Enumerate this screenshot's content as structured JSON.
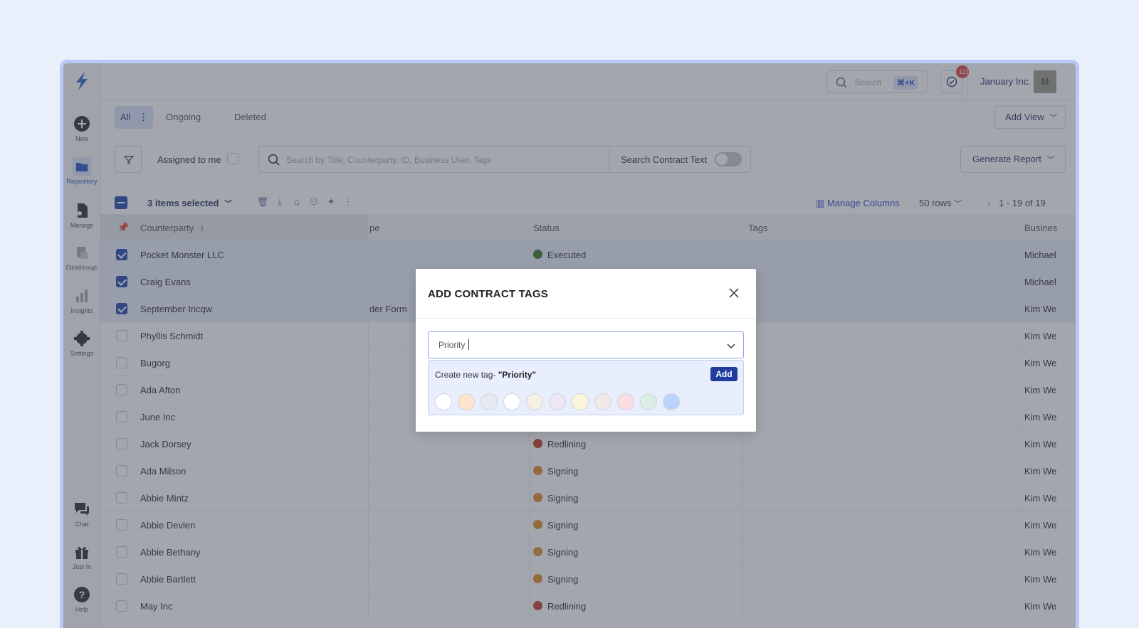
{
  "sidebar": {
    "items": [
      {
        "label": "New",
        "icon": "plus-circle-icon"
      },
      {
        "label": "Repository",
        "icon": "folder-icon"
      },
      {
        "label": "Manage",
        "icon": "manage-doc-icon"
      },
      {
        "label": "Clickthrough",
        "icon": "clickthrough-icon"
      },
      {
        "label": "Insights",
        "icon": "bar-chart-icon"
      },
      {
        "label": "Settings",
        "icon": "gear-icon"
      },
      {
        "label": "Chat",
        "icon": "chat-icon"
      },
      {
        "label": "Just In",
        "icon": "gift-icon"
      },
      {
        "label": "Help",
        "icon": "help-icon"
      }
    ]
  },
  "header": {
    "search_placeholder": "Search",
    "search_shortcut": "⌘+K",
    "notification_count": "12",
    "company": "January Inc.",
    "avatar_initial": "M"
  },
  "tabs": {
    "all": "All",
    "ongoing": "Ongoing",
    "deleted": "Deleted",
    "add_view": "Add View"
  },
  "filters": {
    "assigned_to_me": "Assigned to me",
    "search_placeholder": "Search by Title, Counterparty, ID, Business User, Tags",
    "search_contract_text": "Search Contract Text",
    "generate_report": "Generate Report"
  },
  "selection": {
    "count_label": "3 items selected",
    "manage_columns": "Manage Columns",
    "rows_per_page": "50 rows",
    "pagination": "1 - 19 of 19"
  },
  "table": {
    "headers": {
      "counterparty": "Counterparty",
      "type": "pe",
      "status": "Status",
      "tags": "Tags",
      "business": "Busines"
    },
    "rows": [
      {
        "counterparty": "Pocket Monster LLC",
        "type": "",
        "status": "Executed",
        "business": "Michael",
        "selected": true
      },
      {
        "counterparty": "Craig Evans",
        "type": "",
        "status": "",
        "business": "Michael",
        "selected": true
      },
      {
        "counterparty": "September Incqw",
        "type": "der Form",
        "status": "",
        "business": "Kim We",
        "selected": true
      },
      {
        "counterparty": "Phyllis Schmidt",
        "type": "",
        "status": "",
        "business": "Kim We",
        "selected": false
      },
      {
        "counterparty": "Bugorg",
        "type": "",
        "status": "",
        "business": "Kim We",
        "selected": false
      },
      {
        "counterparty": "Ada Afton",
        "type": "",
        "status": "",
        "business": "Kim We",
        "selected": false
      },
      {
        "counterparty": "June Inc",
        "type": "",
        "status": "",
        "business": "Kim We",
        "selected": false
      },
      {
        "counterparty": "Jack Dorsey",
        "type": "",
        "status": "Redlining",
        "business": "Kim We",
        "selected": false
      },
      {
        "counterparty": "Ada Milson",
        "type": "",
        "status": "Signing",
        "business": "Kim We",
        "selected": false
      },
      {
        "counterparty": "Abbie Mintz",
        "type": "",
        "status": "Signing",
        "business": "Kim We",
        "selected": false
      },
      {
        "counterparty": "Abbie Devlen",
        "type": "",
        "status": "Signing",
        "business": "Kim We",
        "selected": false
      },
      {
        "counterparty": "Abbie Bethany",
        "type": "",
        "status": "Signing",
        "business": "Kim We",
        "selected": false
      },
      {
        "counterparty": "Abbie Bartlett",
        "type": "",
        "status": "Signing",
        "business": "Kim We",
        "selected": false
      },
      {
        "counterparty": "May Inc",
        "type": "",
        "status": "Redlining",
        "business": "Kim We",
        "selected": false
      }
    ]
  },
  "status_colors": {
    "Executed": "#3f7a2a",
    "Redlining": "#c0452a",
    "Signing": "#e1912d"
  },
  "modal": {
    "title": "ADD CONTRACT TAGS",
    "input_value": "Priority",
    "create_prefix": "Create new tag- ",
    "create_value": "\"Priority\"",
    "add_button": "Add",
    "swatches": [
      "#ffffff",
      "#fde4cc",
      "#e6e9f2",
      "#ffffff",
      "#f5efe6",
      "#ece7f3",
      "#fdf5da",
      "#efe9ea",
      "#fbdde3",
      "#dbeee3",
      "#bcd4fb"
    ]
  }
}
